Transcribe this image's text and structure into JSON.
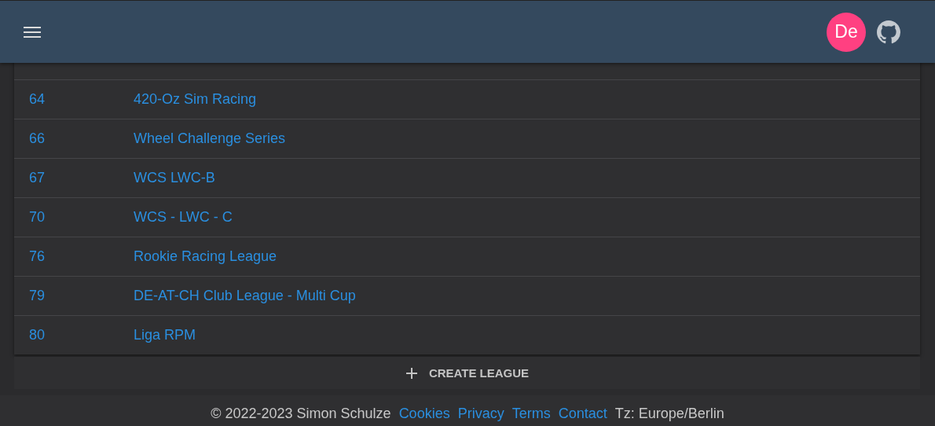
{
  "app_bar": {
    "avatar": "De"
  },
  "leagues": [
    {
      "id": "64",
      "name": "420-Oz Sim Racing"
    },
    {
      "id": "66",
      "name": "Wheel Challenge Series"
    },
    {
      "id": "67",
      "name": "WCS LWC-B"
    },
    {
      "id": "70",
      "name": "WCS - LWC - C"
    },
    {
      "id": "76",
      "name": "Rookie Racing League"
    },
    {
      "id": "79",
      "name": "DE-AT-CH Club League - Multi Cup"
    },
    {
      "id": "80",
      "name": "Liga RPM"
    }
  ],
  "create_button": "CREATE LEAGUE",
  "footer": {
    "copyright": "© 2022-2023 Simon Schulze",
    "links": [
      "Cookies",
      "Privacy",
      "Terms",
      "Contact"
    ],
    "timezone": "Tz: Europe/Berlin"
  }
}
